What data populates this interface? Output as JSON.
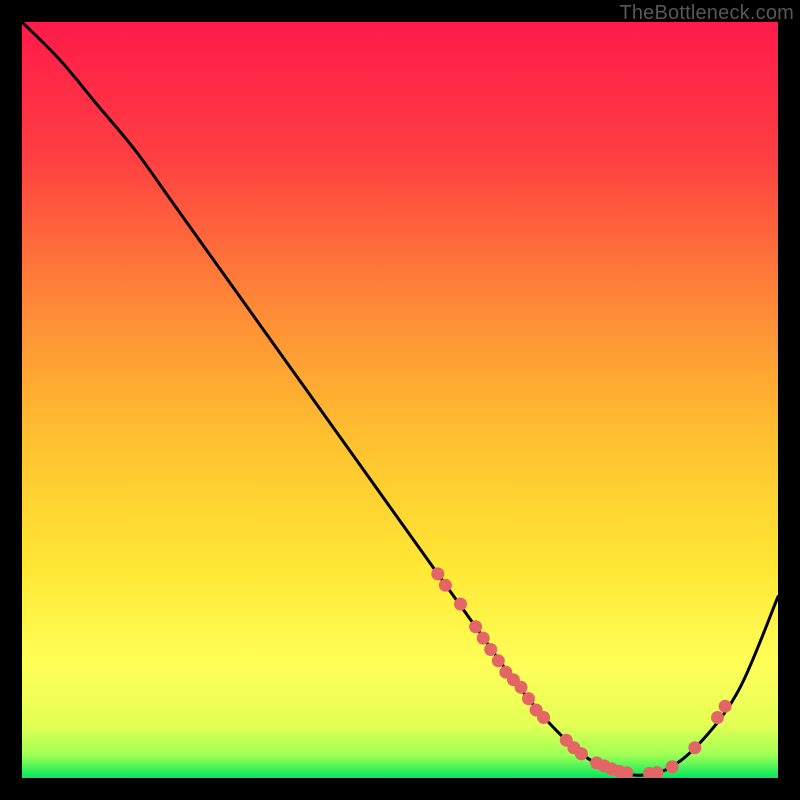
{
  "watermark": "TheBottleneck.com",
  "colors": {
    "gradient_top": "#ff1a4a",
    "gradient_mid1": "#ff6a36",
    "gradient_mid2": "#ffd530",
    "gradient_mid3": "#ffff4a",
    "gradient_bottom": "#00e85c",
    "curve": "#000000",
    "dot": "#e46565",
    "frame_bg": "#000000"
  },
  "chart_data": {
    "type": "line",
    "title": "",
    "xlabel": "",
    "ylabel": "",
    "xlim": [
      0,
      100
    ],
    "ylim": [
      0,
      100
    ],
    "grid": false,
    "legend": false,
    "series": [
      {
        "name": "bottleneck-curve",
        "x": [
          0,
          5,
          10,
          15,
          20,
          25,
          30,
          35,
          40,
          45,
          50,
          55,
          60,
          65,
          70,
          75,
          80,
          85,
          90,
          95,
          100
        ],
        "y": [
          100,
          95,
          89,
          83,
          76,
          69,
          62,
          55,
          48,
          41,
          34,
          27,
          20,
          13,
          7,
          2.5,
          0.5,
          1,
          5,
          12,
          24
        ]
      }
    ],
    "points": [
      {
        "x": 55,
        "y": 27
      },
      {
        "x": 56,
        "y": 25.5
      },
      {
        "x": 58,
        "y": 23
      },
      {
        "x": 60,
        "y": 20
      },
      {
        "x": 61,
        "y": 18.5
      },
      {
        "x": 62,
        "y": 17
      },
      {
        "x": 63,
        "y": 15.5
      },
      {
        "x": 64,
        "y": 14
      },
      {
        "x": 65,
        "y": 13
      },
      {
        "x": 66,
        "y": 12
      },
      {
        "x": 67,
        "y": 10.5
      },
      {
        "x": 68,
        "y": 9
      },
      {
        "x": 69,
        "y": 8
      },
      {
        "x": 72,
        "y": 5
      },
      {
        "x": 73,
        "y": 4
      },
      {
        "x": 74,
        "y": 3.2
      },
      {
        "x": 76,
        "y": 2
      },
      {
        "x": 77,
        "y": 1.6
      },
      {
        "x": 78,
        "y": 1.2
      },
      {
        "x": 79,
        "y": 0.9
      },
      {
        "x": 80,
        "y": 0.7
      },
      {
        "x": 83,
        "y": 0.6
      },
      {
        "x": 84,
        "y": 0.7
      },
      {
        "x": 86,
        "y": 1.5
      },
      {
        "x": 89,
        "y": 4
      },
      {
        "x": 92,
        "y": 8
      },
      {
        "x": 93,
        "y": 9.5
      }
    ]
  }
}
